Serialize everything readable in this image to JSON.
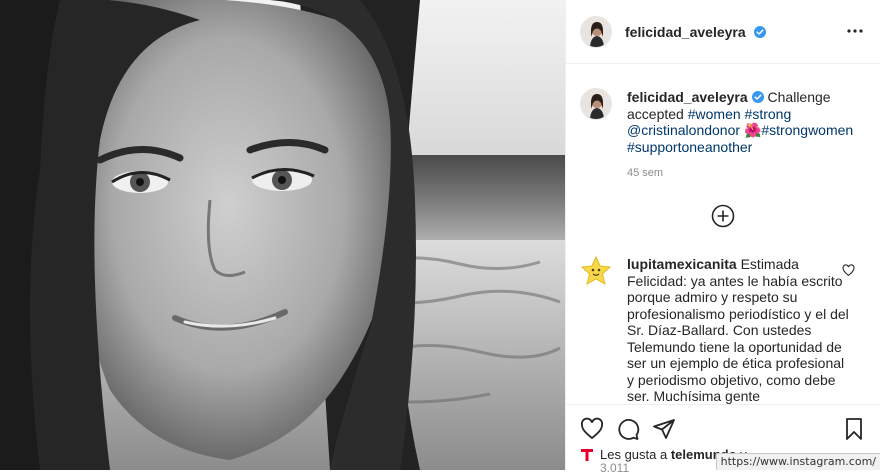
{
  "post": {
    "author": "felicidad_aveleyra",
    "verified": true,
    "caption": {
      "username": "felicidad_aveleyra",
      "text_start": " Challenge accepted ",
      "tag_women": "#women",
      "tag_strong": "#strong",
      "mention": "@cristinalondonor",
      "emoji": "🌺",
      "tag_strongwomen": "#strongwomen",
      "tag_support": "#supportoneanother"
    },
    "timestamp": "45 sem"
  },
  "comments": [
    {
      "username": "lupitamexicanita",
      "text": "Estimada Felicidad: ya antes le había escrito porque admiro y respeto su profesionalismo periodístico y el del Sr. Díaz-Ballard. Con ustedes Telemundo tiene la oportunidad de ser un ejemplo de ética profesional y periodismo objetivo, como debe ser. Muchísima gente"
    }
  ],
  "likes": {
    "prefix": "Les gusta a ",
    "user": "telemundo",
    "suffix": " y",
    "partial_count": "3.011"
  },
  "status_bar": {
    "url": "https://www.instagram.com/"
  },
  "colors": {
    "verified": "#3897f0",
    "link": "#00376b",
    "muted": "#8e8e8e",
    "telemundo_red": "#e4002b"
  },
  "icons": {
    "more": "more-horizontal-icon",
    "add_comment": "plus-circle-icon",
    "like": "heart-icon",
    "comment": "comment-icon",
    "share": "paper-plane-icon",
    "save": "bookmark-icon"
  }
}
